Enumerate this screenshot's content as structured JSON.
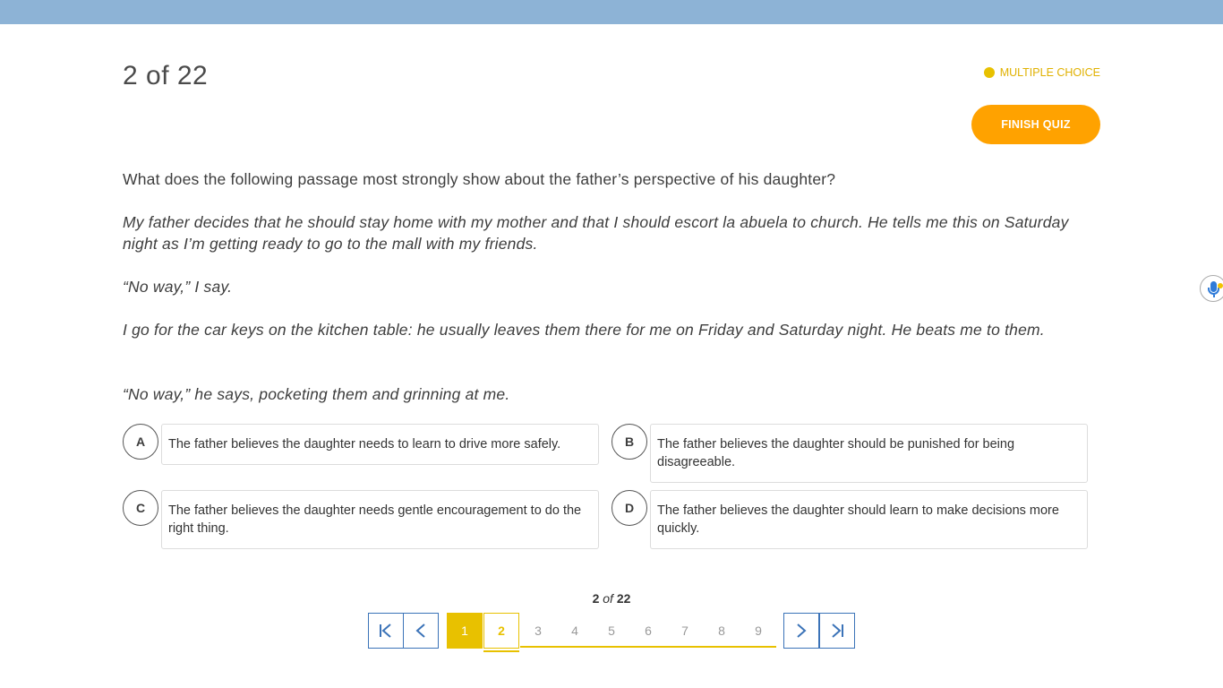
{
  "header": {
    "counter": "2 of 22",
    "question_type": "MULTIPLE CHOICE",
    "finish_label": "FINISH QUIZ"
  },
  "question": {
    "prompt": "What does the following passage most strongly show about the father’s perspective of his daughter?",
    "passage": [
      "My father decides that he should stay home with my mother and that I should escort la abuela to church. He tells me this on Saturday night as I’m getting ready to go to the mall with my friends.",
      "“No way,” I say.",
      "I go for the car keys on the kitchen table: he usually leaves them there for me on Friday and Saturday night. He beats me to them.",
      "“No way,” he says, pocketing them and grinning at me."
    ]
  },
  "options": [
    {
      "letter": "A",
      "text": "The father believes the daughter needs to learn to drive more safely."
    },
    {
      "letter": "B",
      "text": "The father believes the daughter should be punished for being disagreeable."
    },
    {
      "letter": "C",
      "text": "The father believes the daughter needs gentle encouragement to do the right thing."
    },
    {
      "letter": "D",
      "text": "The father believes the daughter should learn to make decisions more quickly."
    }
  ],
  "pagination": {
    "current": "2",
    "of": "of",
    "total": "22",
    "pages": [
      "1",
      "2",
      "3",
      "4",
      "5",
      "6",
      "7",
      "8",
      "9"
    ],
    "first_icon": "first-page-icon",
    "prev_icon": "chevron-left-icon",
    "next_icon": "chevron-right-icon",
    "last_icon": "last-page-icon"
  },
  "widgets": {
    "mic_icon": "microphone-icon"
  },
  "colors": {
    "topbar": "#8db3d6",
    "accent_yellow": "#e8c100",
    "finish_orange": "#ffa200",
    "nav_blue": "#3b73b8"
  }
}
